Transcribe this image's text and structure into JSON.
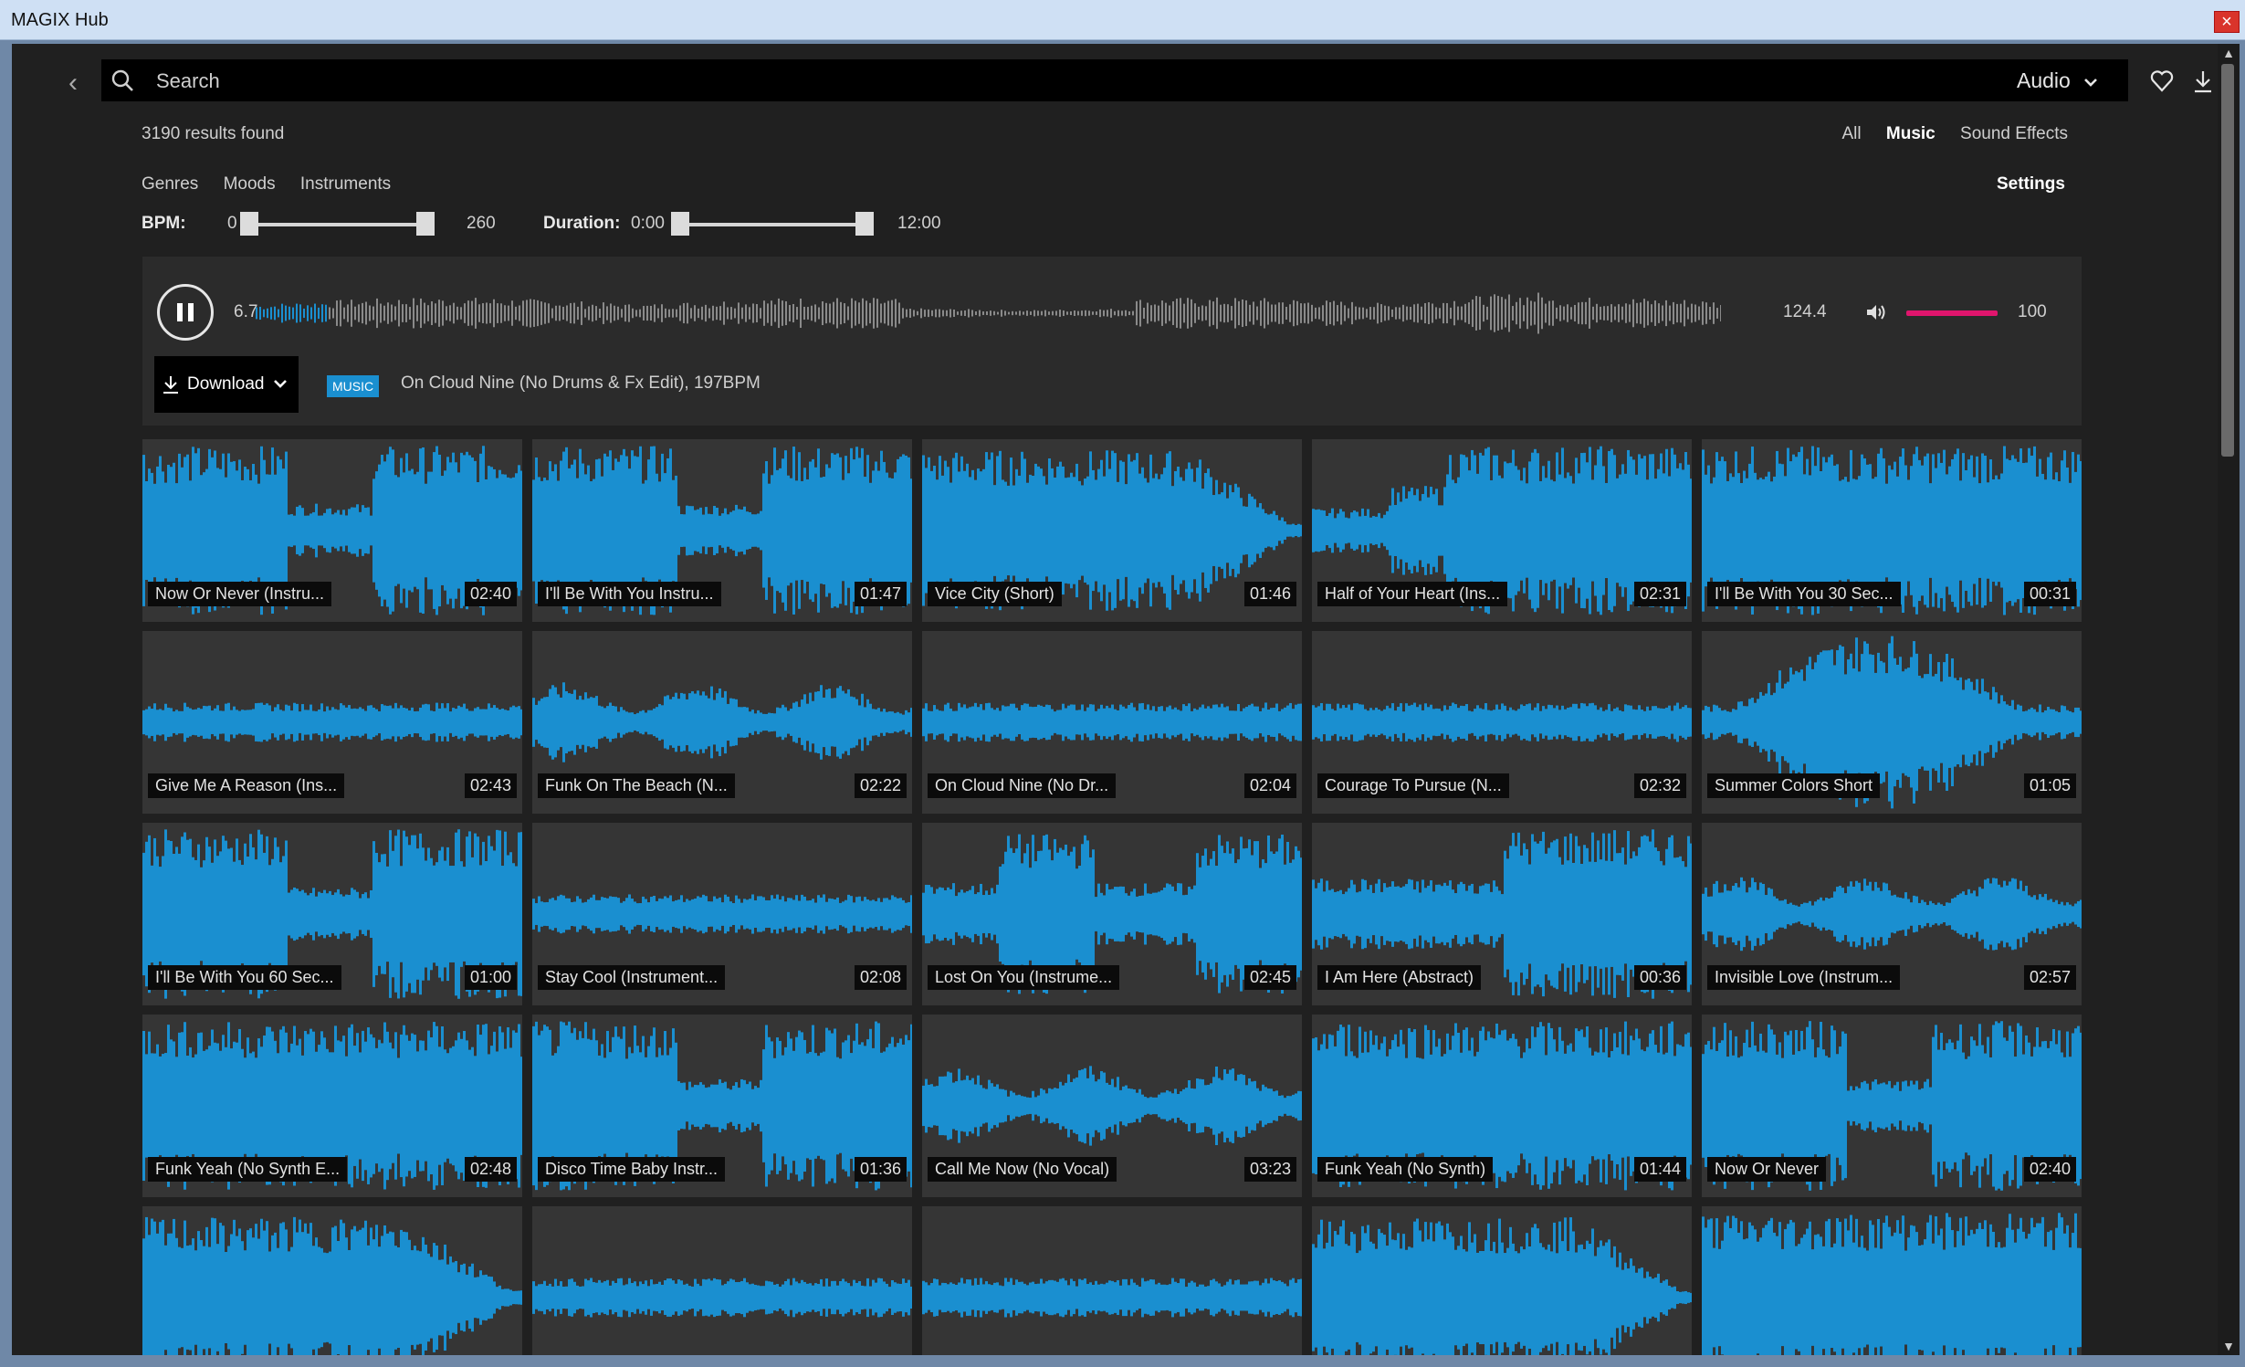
{
  "window": {
    "title": "MAGIX Hub",
    "close_glyph": "×"
  },
  "toolbar": {
    "back_glyph": "‹",
    "search_placeholder": "Search",
    "media_type": "Audio",
    "icons": [
      "search-icon",
      "heart-icon",
      "download-icon",
      "chevron-down-icon",
      "back-icon"
    ]
  },
  "results": {
    "count_text": "3190 results found"
  },
  "filters": {
    "all": "All",
    "music": "Music",
    "sound_effects": "Sound Effects",
    "active": "Music"
  },
  "categories": {
    "genres": "Genres",
    "moods": "Moods",
    "instruments": "Instruments"
  },
  "settings_label": "Settings",
  "bpm": {
    "label": "BPM:",
    "min": "0",
    "max": "260"
  },
  "duration": {
    "label": "Duration:",
    "min": "0:00",
    "max": "12:00"
  },
  "player": {
    "position": "6.7",
    "length": "124.4",
    "volume": "100",
    "state": "playing",
    "download_label": "Download",
    "badge": "MUSIC",
    "track_title": "On Cloud Nine (No Drums & Fx Edit), 197BPM",
    "accent_color": "#e0156d",
    "wave_color": "#3e3e3e"
  },
  "tiles": [
    {
      "name": "Now Or Never (Instru...",
      "time": "02:40",
      "shape": "dip"
    },
    {
      "name": "I'll Be With You Instru...",
      "time": "01:47",
      "shape": "dip"
    },
    {
      "name": "Vice City (Short)",
      "time": "01:46",
      "shape": "fadeout"
    },
    {
      "name": "Half of Your Heart (Ins...",
      "time": "02:31",
      "shape": "fadein"
    },
    {
      "name": "I'll Be With You 30 Sec...",
      "time": "00:31",
      "shape": "full"
    },
    {
      "name": "Give Me A Reason (Ins...",
      "time": "02:43",
      "shape": "flat"
    },
    {
      "name": "Funk On The Beach (N...",
      "time": "02:22",
      "shape": "flatmid"
    },
    {
      "name": "On Cloud Nine (No Dr...",
      "time": "02:04",
      "shape": "flat"
    },
    {
      "name": "Courage To Pursue (N...",
      "time": "02:32",
      "shape": "flat"
    },
    {
      "name": "Summer Colors Short",
      "time": "01:05",
      "shape": "bulge"
    },
    {
      "name": "I'll Be With You 60 Sec...",
      "time": "01:00",
      "shape": "dip"
    },
    {
      "name": "Stay Cool (Instrument...",
      "time": "02:08",
      "shape": "flat"
    },
    {
      "name": "Lost On You (Instrume...",
      "time": "02:45",
      "shape": "twin"
    },
    {
      "name": "I Am Here (Abstract)",
      "time": "00:36",
      "shape": "rise"
    },
    {
      "name": "Invisible Love (Instrum...",
      "time": "02:57",
      "shape": "flatmid"
    },
    {
      "name": "Funk Yeah (No Synth E...",
      "time": "02:48",
      "shape": "full"
    },
    {
      "name": "Disco Time Baby Instr...",
      "time": "01:36",
      "shape": "dip"
    },
    {
      "name": "Call Me Now (No Vocal)",
      "time": "03:23",
      "shape": "flatmid"
    },
    {
      "name": "Funk Yeah (No Synth)",
      "time": "01:44",
      "shape": "full"
    },
    {
      "name": "Now Or Never",
      "time": "02:40",
      "shape": "dip"
    },
    {
      "name": "",
      "time": "",
      "shape": "fadeout"
    },
    {
      "name": "",
      "time": "",
      "shape": "flat"
    },
    {
      "name": "",
      "time": "",
      "shape": "flat"
    },
    {
      "name": "",
      "time": "",
      "shape": "fadeout"
    },
    {
      "name": "",
      "time": "",
      "shape": "full"
    }
  ],
  "tile_wave_color": "#1a8fd0",
  "tile_bg_color": "#353535"
}
